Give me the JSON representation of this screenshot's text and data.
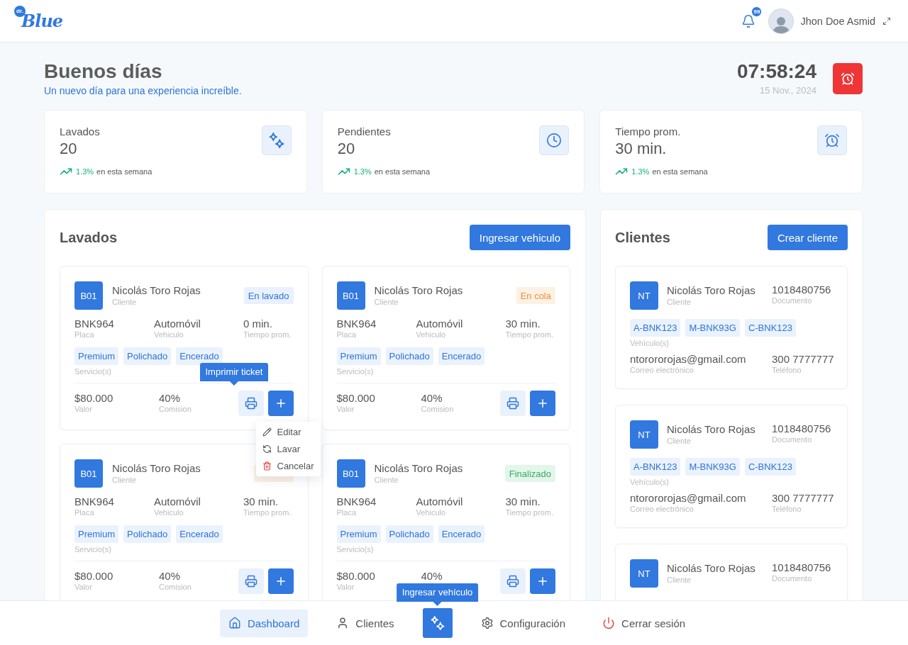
{
  "header": {
    "logo": {
      "badge": "dr.",
      "name": "Blue"
    },
    "notifications": {
      "count": "99"
    },
    "user": {
      "name": "Jhon Doe Asmid"
    }
  },
  "greeting": {
    "title": "Buenos días",
    "subtitle": "Un nuevo día para una experiencia increíble.",
    "time": "07:58:24",
    "date": "15 Nov., 2024"
  },
  "stats": [
    {
      "kind": "washes",
      "label": "Lavados",
      "value": "20",
      "trend_value": "1.3%",
      "trend_label": "en esta semana"
    },
    {
      "kind": "pending",
      "label": "Pendientes",
      "value": "20",
      "trend_value": "1.3%",
      "trend_label": "en esta semana"
    },
    {
      "kind": "time",
      "label": "Tiempo prom.",
      "value": "30 min.",
      "trend_value": "1.3%",
      "trend_label": "en esta semana"
    }
  ],
  "lavados": {
    "title": "Lavados",
    "button": "Ingresar vehiculo",
    "cards": [
      {
        "code": "B01",
        "name": "Nicolás Toro Rojas",
        "name_label": "Cliente",
        "status": {
          "kind": "washing",
          "label": "En lavado"
        },
        "plate": "BNK964",
        "plate_label": "Placa",
        "vehicle": "Automóvil",
        "vehicle_label": "Vehiculo",
        "time": "0 min.",
        "time_label": "Tiempo prom.",
        "services": [
          "Premium",
          "Polichado",
          "Encerado"
        ],
        "services_label": "Servicio(s)",
        "price": "$80.000",
        "price_label": "Valor",
        "commission": "40%",
        "commission_label": "Comision",
        "print_tooltip": "Imprimir ticket",
        "menu": [
          {
            "kind": "edit",
            "label": "Editar"
          },
          {
            "kind": "wash",
            "label": "Lavar"
          },
          {
            "kind": "cancel",
            "label": "Cancelar"
          }
        ]
      },
      {
        "code": "B01",
        "name": "Nicolás Toro Rojas",
        "name_label": "Cliente",
        "status": {
          "kind": "queued",
          "label": "En cola"
        },
        "plate": "BNK964",
        "plate_label": "Placa",
        "vehicle": "Automóvil",
        "vehicle_label": "Vehiculo",
        "time": "30 min.",
        "time_label": "Tiempo prom.",
        "services": [
          "Premium",
          "Polichado",
          "Encerado"
        ],
        "services_label": "Servicio(s)",
        "price": "$80.000",
        "price_label": "Valor",
        "commission": "40%",
        "commission_label": "Comision"
      },
      {
        "code": "B01",
        "name": "Nicolás Toro Rojas",
        "name_label": "Cliente",
        "status": {
          "kind": "queued"
        },
        "plate": "BNK964",
        "plate_label": "Placa",
        "vehicle": "Automóvil",
        "vehicle_label": "Vehiculo",
        "time": "30 min.",
        "time_label": "Tiempo prom.",
        "services": [
          "Premium",
          "Polichado",
          "Encerado"
        ],
        "services_label": "Servicio(s)",
        "price": "$80.000",
        "price_label": "Valor",
        "commission": "40%",
        "commission_label": "Comision"
      },
      {
        "code": "B01",
        "name": "Nicolás Toro Rojas",
        "name_label": "Cliente",
        "status": {
          "kind": "done",
          "label": "Finalizado"
        },
        "plate": "BNK964",
        "plate_label": "Placa",
        "vehicle": "Automóvil",
        "vehicle_label": "Vehiculo",
        "time": "30 min.",
        "time_label": "Tiempo prom.",
        "services": [
          "Premium",
          "Polichado",
          "Encerado"
        ],
        "services_label": "Servicio(s)",
        "price": "$80.000",
        "price_label": "Valor",
        "commission": "40%"
      }
    ]
  },
  "clientes": {
    "title": "Clientes",
    "button": "Crear cliente",
    "cards": [
      {
        "initials": "NT",
        "name": "Nicolás Toro Rojas",
        "name_label": "Cliente",
        "document": "1018480756",
        "document_label": "Documento",
        "vehicles": [
          "A-BNK123",
          "M-BNK93G",
          "C-BNK123"
        ],
        "vehicles_label": "Vehículo(s)",
        "email": "ntorororojas@gmail.com",
        "email_label": "Correo electrónico",
        "phone": "300 7777777",
        "phone_label": "Teléfono"
      },
      {
        "initials": "NT",
        "name": "Nicolás Toro Rojas",
        "name_label": "Cliente",
        "document": "1018480756",
        "document_label": "Documento",
        "vehicles": [
          "A-BNK123",
          "M-BNK93G",
          "C-BNK123"
        ],
        "vehicles_label": "Vehículo(s)",
        "email": "ntorororojas@gmail.com",
        "email_label": "Correo electrónico",
        "phone": "300 7777777",
        "phone_label": "Teléfono"
      },
      {
        "initials": "NT",
        "name": "Nicolás Toro Rojas",
        "name_label": "Cliente",
        "document": "1018480756",
        "document_label": "Documento"
      }
    ]
  },
  "nav": {
    "items": [
      {
        "kind": "dashboard",
        "label": "Dashboard",
        "selected": true
      },
      {
        "kind": "clients",
        "label": "Clientes",
        "selected": false
      },
      {
        "kind": "add",
        "tooltip": "Ingresar vehículo",
        "selected": false
      },
      {
        "kind": "settings",
        "label": "Configuración",
        "selected": false
      },
      {
        "kind": "logout",
        "label": "Cerrar sesión",
        "selected": false
      }
    ]
  }
}
